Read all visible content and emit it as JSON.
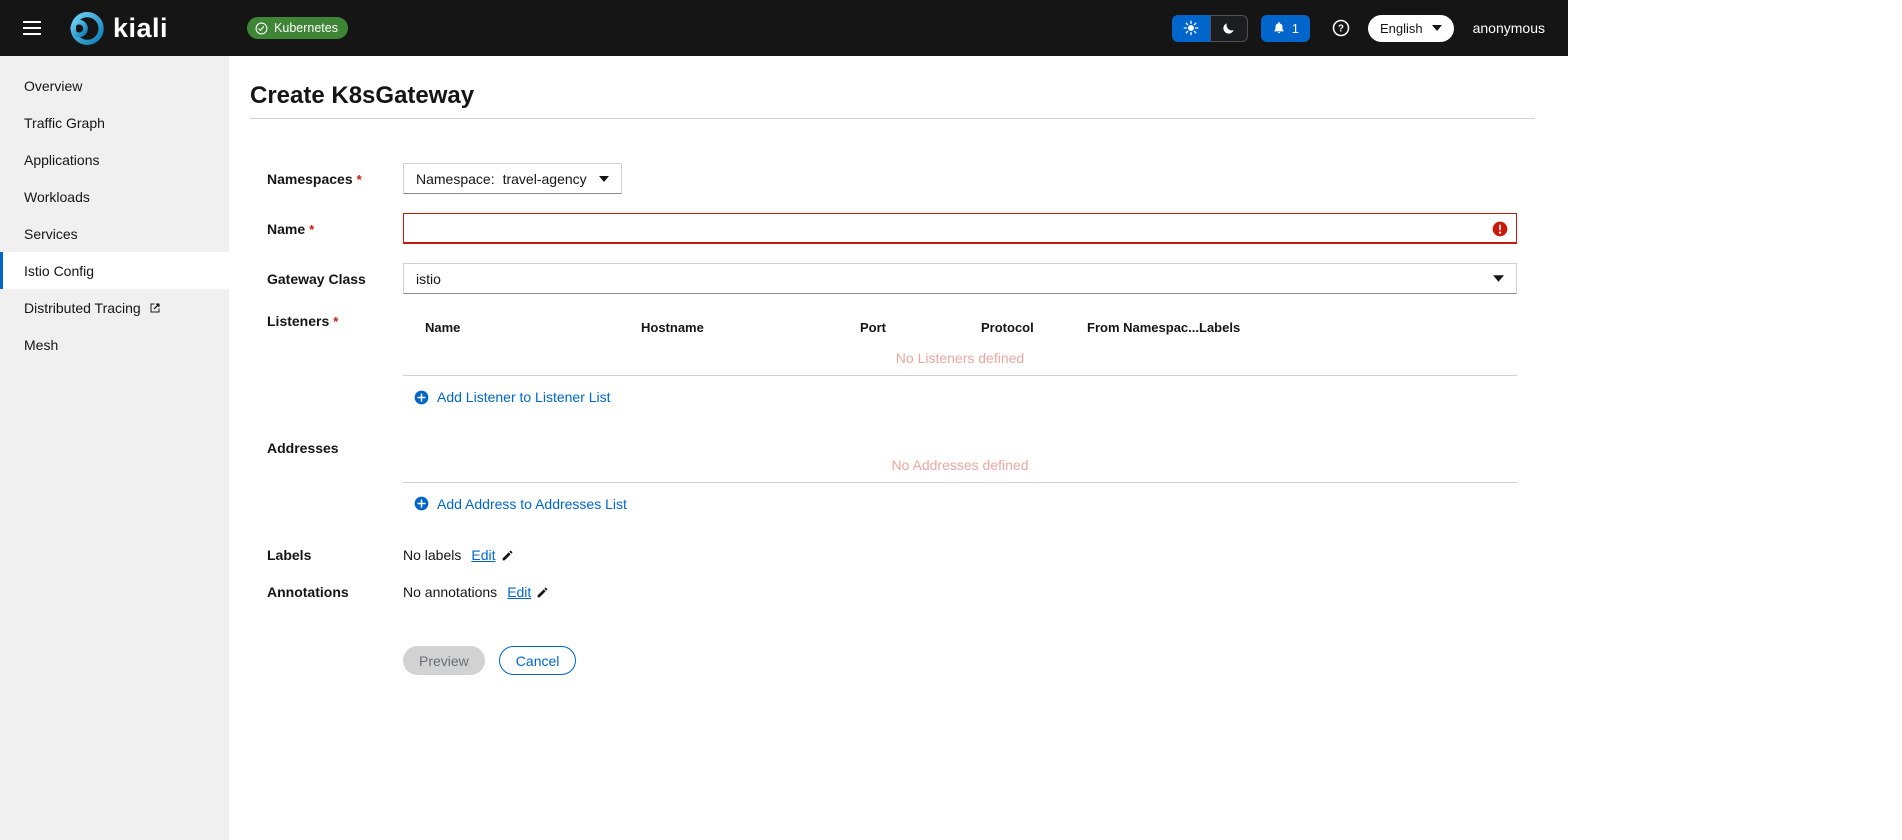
{
  "masthead": {
    "brand": "kiali",
    "kubernetes_badge": "Kubernetes",
    "notification_count": "1",
    "language": "English",
    "user": "anonymous"
  },
  "sidebar": {
    "items": [
      {
        "label": "Overview"
      },
      {
        "label": "Traffic Graph"
      },
      {
        "label": "Applications"
      },
      {
        "label": "Workloads"
      },
      {
        "label": "Services"
      },
      {
        "label": "Istio Config",
        "active": true
      },
      {
        "label": "Distributed Tracing",
        "external": true
      },
      {
        "label": "Mesh"
      }
    ]
  },
  "page": {
    "title": "Create K8sGateway"
  },
  "form": {
    "required_marker": "*",
    "namespaces": {
      "label": "Namespaces",
      "dropdown_prefix": "Namespace:",
      "value": "travel-agency"
    },
    "name": {
      "label": "Name",
      "value": ""
    },
    "gateway_class": {
      "label": "Gateway Class",
      "value": "istio"
    },
    "listeners": {
      "label": "Listeners",
      "columns": [
        "Name",
        "Hostname",
        "Port",
        "Protocol",
        "From Namespac...",
        "Labels"
      ],
      "empty_message": "No Listeners defined",
      "add_label": "Add Listener to Listener List"
    },
    "addresses": {
      "label": "Addresses",
      "empty_message": "No Addresses defined",
      "add_label": "Add Address to Addresses List"
    },
    "labels": {
      "label": "Labels",
      "value": "No labels",
      "edit_label": "Edit"
    },
    "annotations": {
      "label": "Annotations",
      "value": "No annotations",
      "edit_label": "Edit"
    },
    "actions": {
      "preview": "Preview",
      "cancel": "Cancel"
    }
  },
  "colors": {
    "accent": "#0066cc",
    "danger": "#c9190b",
    "success_badge": "#3e8635",
    "masthead_bg": "#151515",
    "sidebar_bg": "#f0f0f0",
    "empty_state_text": "#eaa7a2"
  }
}
